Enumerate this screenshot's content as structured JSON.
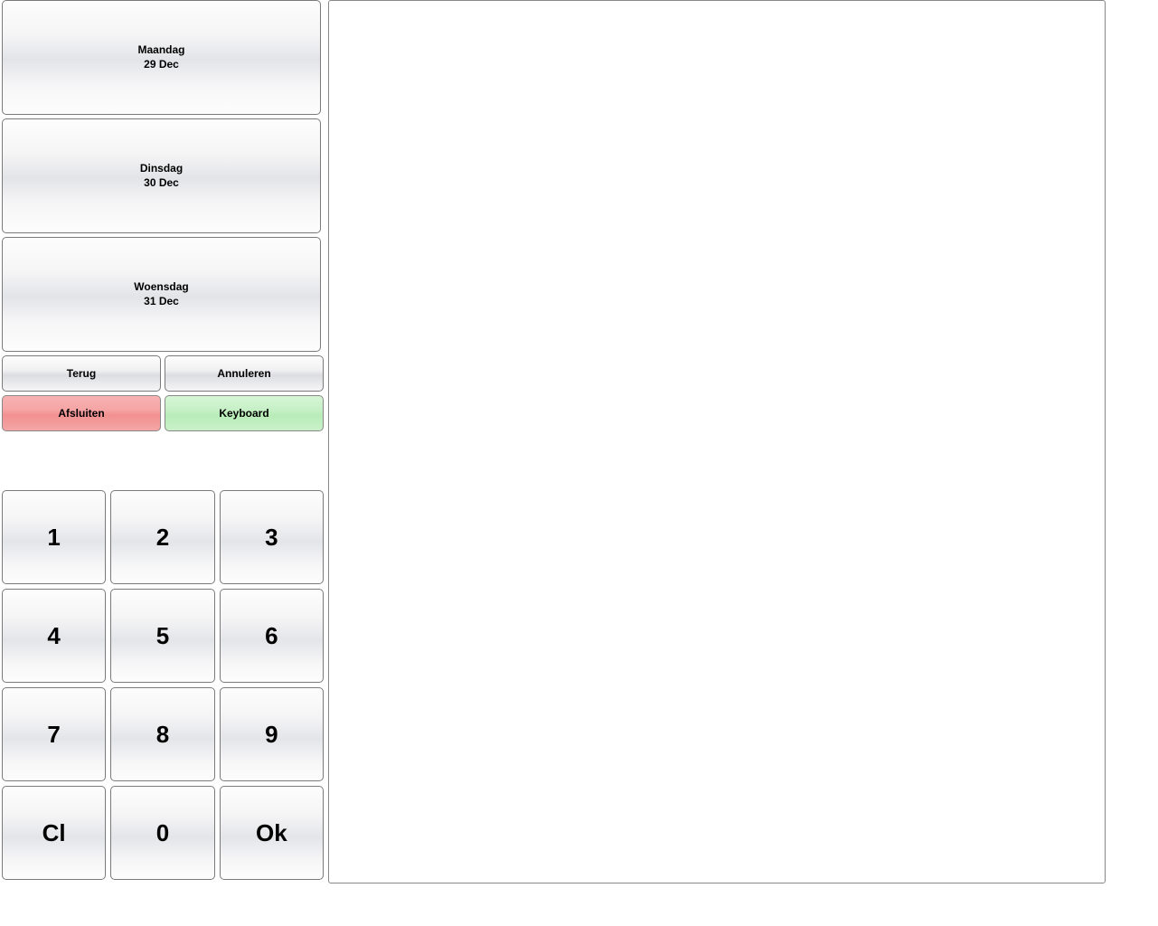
{
  "days": [
    {
      "name": "Maandag",
      "date": "29 Dec"
    },
    {
      "name": "Dinsdag",
      "date": "30 Dec"
    },
    {
      "name": "Woensdag",
      "date": "31 Dec"
    }
  ],
  "actions": {
    "back": "Terug",
    "cancel": "Annuleren",
    "close": "Afsluiten",
    "keyboard": "Keyboard"
  },
  "keypad": {
    "k1": "1",
    "k2": "2",
    "k3": "3",
    "k4": "4",
    "k5": "5",
    "k6": "6",
    "k7": "7",
    "k8": "8",
    "k9": "9",
    "clear": "Cl",
    "k0": "0",
    "ok": "Ok"
  }
}
